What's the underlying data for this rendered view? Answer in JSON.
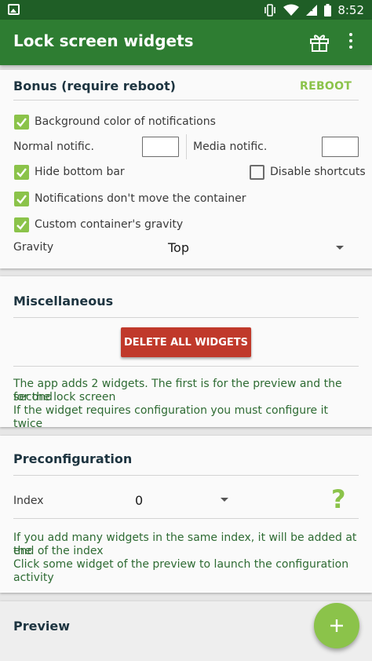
{
  "status_bar": {
    "time": "8:52"
  },
  "app_bar": {
    "title": "Lock screen widgets"
  },
  "bonus": {
    "title": "Bonus (require reboot)",
    "reboot_label": "REBOOT",
    "background_color": {
      "label": "Background color of notifications",
      "checked": true
    },
    "normal_notific": "Normal notific.",
    "media_notific": "Media notific.",
    "hide_bottom_bar": {
      "label": "Hide bottom bar",
      "checked": true
    },
    "disable_shortcuts": {
      "label": "Disable shortcuts",
      "checked": false
    },
    "notif_container": {
      "label": "Notifications don't move the container",
      "checked": true
    },
    "custom_gravity": {
      "label": "Custom container's gravity",
      "checked": true
    },
    "gravity_label": "Gravity",
    "gravity_value": "Top"
  },
  "misc": {
    "title": "Miscellaneous",
    "delete_label": "DELETE ALL WIDGETS",
    "info_1": "The app adds 2 widgets. The first is for the preview and the second",
    "info_2": "for the lock screen",
    "info_3": "If the widget requires configuration you must configure it twice"
  },
  "preconfig": {
    "title": "Preconfiguration",
    "index_label": "Index",
    "index_value": "0",
    "help_glyph": "?",
    "info_1": "If you add many widgets in the same index, it will be added at the",
    "info_2": "end of the index",
    "info_3": "Click some widget of the preview to launch the configuration",
    "info_4": "activity"
  },
  "preview": {
    "title": "Preview"
  },
  "fab": {
    "glyph": "+"
  }
}
